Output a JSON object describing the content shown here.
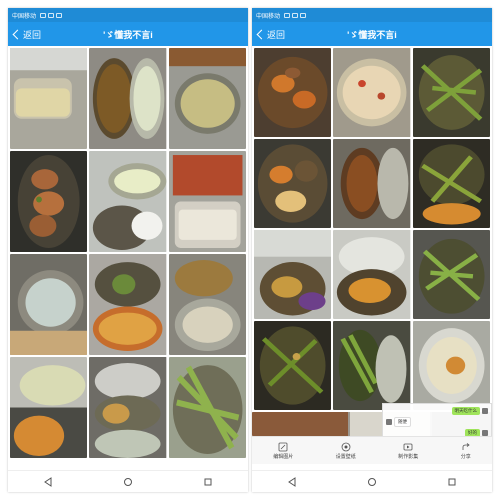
{
  "colors": {
    "accent": "#2196e8",
    "statusbar": "#1f8bd6"
  },
  "left": {
    "statusbar": {
      "carrier": "中国移动"
    },
    "nav": {
      "back_label": "返回",
      "title": "'ゞ懂我不言i"
    }
  },
  "right": {
    "statusbar": {
      "carrier": "中国移动"
    },
    "nav": {
      "back_label": "返回",
      "title": "'ゞ懂我不言i"
    },
    "toolbar": [
      {
        "label": "编辑图片",
        "icon": "edit-icon"
      },
      {
        "label": "设置壁纸",
        "icon": "wallpaper-icon"
      },
      {
        "label": "制作影集",
        "icon": "video-album-icon"
      },
      {
        "label": "分享",
        "icon": "share-icon"
      }
    ],
    "chat_overlay": {
      "lines": [
        "明天吃什么",
        "随便",
        "好的",
        "每天都吃好的"
      ]
    }
  },
  "android_nav": [
    "back-key",
    "home-key",
    "recents-key"
  ]
}
